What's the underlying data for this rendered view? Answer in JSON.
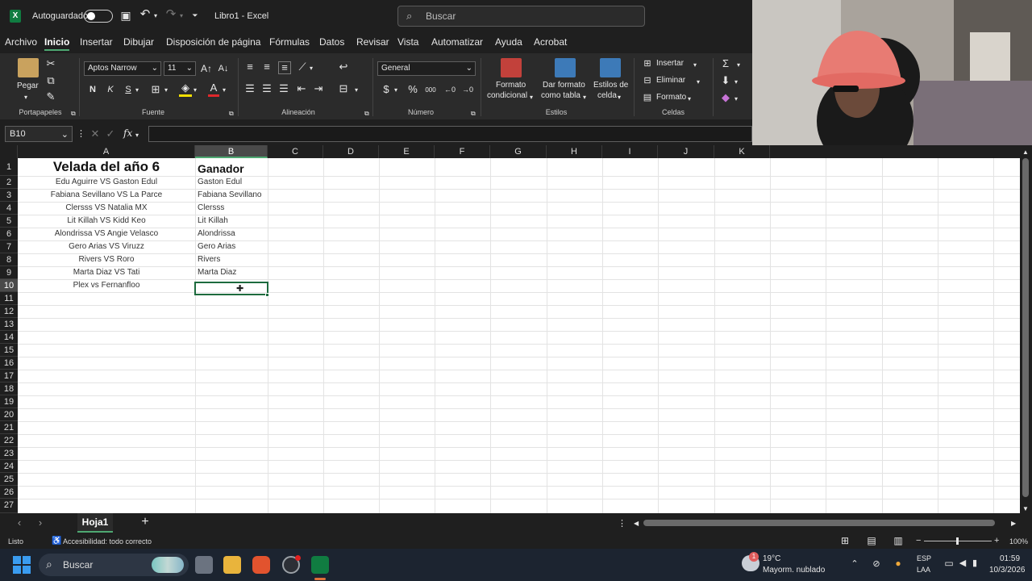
{
  "titlebar": {
    "autosave_label": "Autoguardado",
    "doc_title": "Libro1 - Excel",
    "search_placeholder": "Buscar"
  },
  "tabs": [
    "Archivo",
    "Inicio",
    "Insertar",
    "Dibujar",
    "Disposición de página",
    "Fórmulas",
    "Datos",
    "Revisar",
    "Vista",
    "Automatizar",
    "Ayuda",
    "Acrobat"
  ],
  "ribbon": {
    "paste_label": "Pegar",
    "font_name": "Aptos Narrow",
    "font_size": "11",
    "bold": "N",
    "italic": "K",
    "underline": "S",
    "number_format": "General",
    "conditional_format": [
      "Formato",
      "condicional"
    ],
    "format_table": [
      "Dar formato",
      "como tabla"
    ],
    "cell_styles": [
      "Estilos de",
      "celda"
    ],
    "insert": "Insertar",
    "delete": "Eliminar",
    "format": "Formato",
    "groups": {
      "clipboard": "Portapapeles",
      "font": "Fuente",
      "alignment": "Alineación",
      "number": "Número",
      "styles": "Estilos",
      "cells": "Celdas"
    }
  },
  "formula_bar": {
    "name_box": "B10",
    "fx": "fx"
  },
  "columns": [
    "A",
    "B",
    "C",
    "D",
    "E",
    "F",
    "G",
    "H",
    "I",
    "J",
    "K"
  ],
  "selected_column": "B",
  "rows": [
    "1",
    "2",
    "3",
    "4",
    "5",
    "6",
    "7",
    "8",
    "9",
    "10",
    "11",
    "12",
    "13",
    "14",
    "15",
    "16",
    "17",
    "18",
    "19",
    "20",
    "21",
    "22",
    "23",
    "24",
    "25",
    "26",
    "27"
  ],
  "selected_row": "10",
  "cells": {
    "a1": "Velada del año 6",
    "b1": "Ganador",
    "col_a": [
      "Edu Aguirre VS Gaston Edul",
      "Fabiana Sevillano VS La Parce",
      "Clersss VS Natalia MX",
      "Lit Killah VS Kidd Keo",
      "Alondrissa VS Angie Velasco",
      "Gero Arias VS Viruzz",
      "Rivers VS Roro",
      "Marta Diaz VS Tati",
      "Plex vs Fernanfloo"
    ],
    "col_b": [
      "Gaston Edul",
      "Fabiana Sevillano",
      "Clersss",
      "Lit Killah",
      "Alondrissa",
      "Gero Arias",
      "Rivers",
      "Marta Diaz",
      ""
    ]
  },
  "sheet_tab": "Hoja1",
  "status": {
    "ready": "Listo",
    "accessibility": "Accesibilidad: todo correcto",
    "zoom": "100%"
  },
  "taskbar": {
    "search": "Buscar",
    "weather_temp": "19°C",
    "weather_desc": "Mayorm. nublado",
    "lang_top": "ESP",
    "lang_bottom": "LAA",
    "time": "01:59",
    "date": "10/3/2026",
    "weather_badge": "1"
  }
}
